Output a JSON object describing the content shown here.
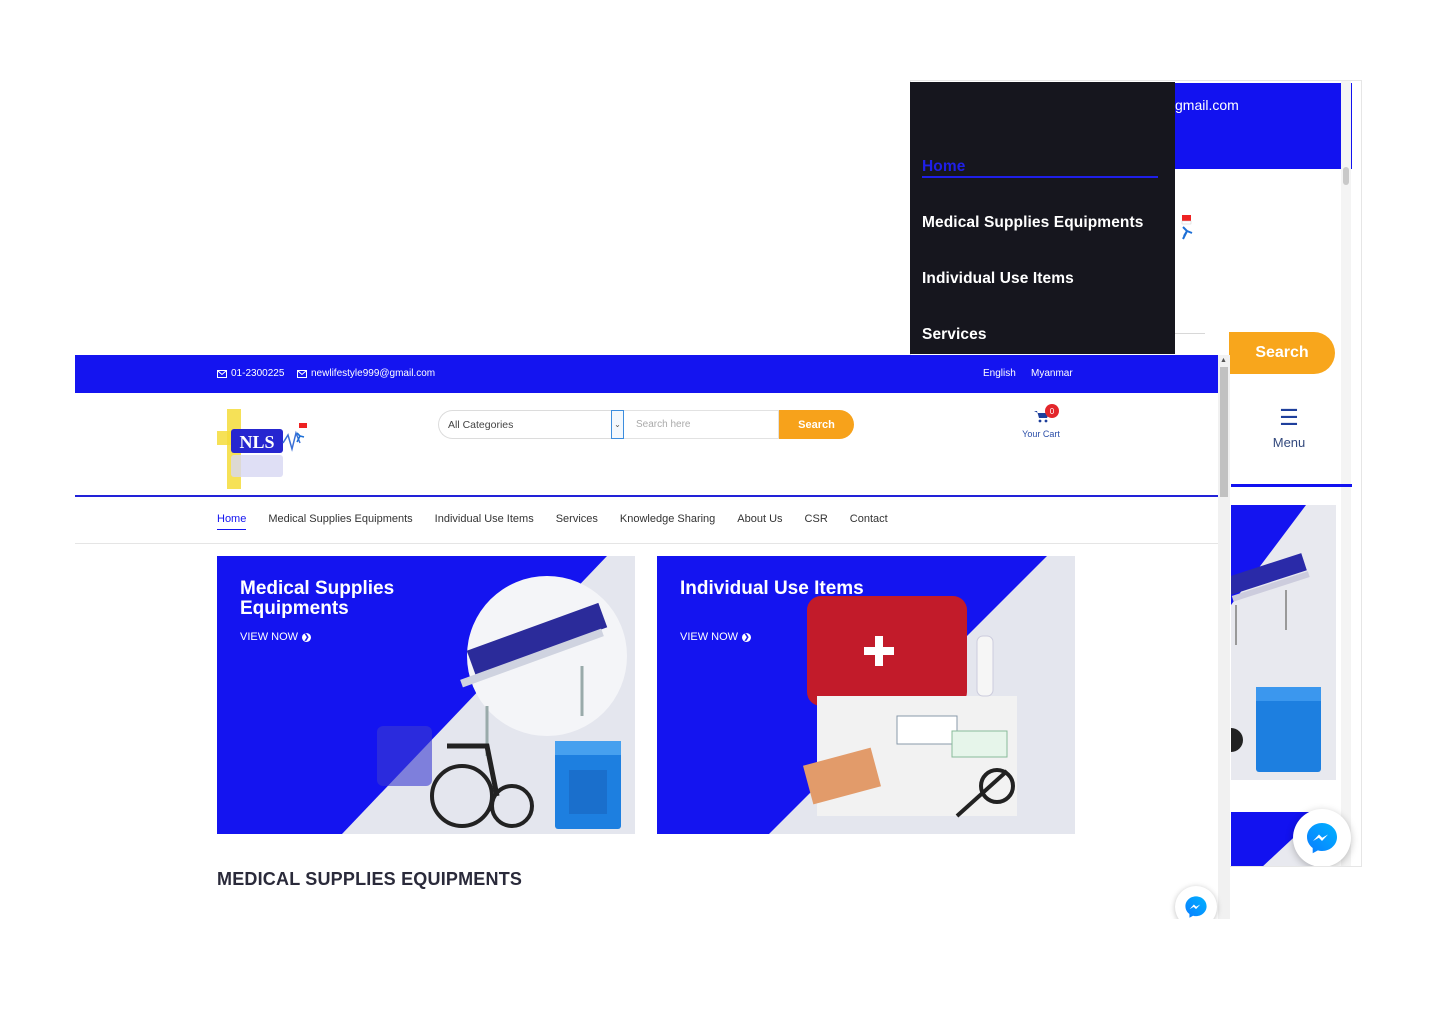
{
  "mobile": {
    "email_fragment": "gmail.com",
    "search_label": "Search",
    "menu_label": "Menu",
    "drawer": {
      "items": [
        {
          "label": "Home",
          "active": true
        },
        {
          "label": "Medical Supplies Equipments",
          "active": false
        },
        {
          "label": "Individual Use Items",
          "active": false
        },
        {
          "label": "Services",
          "active": false
        }
      ]
    }
  },
  "desktop": {
    "topbar": {
      "phone": "01-2300225",
      "email": "newlifestyle999@gmail.com",
      "languages": [
        "English",
        "Myanmar"
      ]
    },
    "logo_text": "NLS",
    "search": {
      "category": "All Categories",
      "placeholder": "Search here",
      "button": "Search"
    },
    "cart": {
      "count": "0",
      "label": "Your Cart"
    },
    "nav": [
      "Home",
      "Medical Supplies Equipments",
      "Individual Use Items",
      "Services",
      "Knowledge Sharing",
      "About Us",
      "CSR",
      "Contact"
    ],
    "banners": [
      {
        "title": "Medical Supplies Equipments",
        "cta": "VIEW NOW"
      },
      {
        "title": "Individual Use Items",
        "cta": "VIEW NOW"
      }
    ],
    "section_title": "MEDICAL SUPPLIES EQUIPMENTS"
  },
  "colors": {
    "brand_blue": "#1414f0",
    "accent_orange": "#f7a21b",
    "drawer_bg": "#16161e",
    "badge_red": "#e3262b"
  },
  "icons": [
    "envelope-icon",
    "chevron-down-icon",
    "cart-icon",
    "hamburger-icon",
    "arrow-circle-right-icon",
    "messenger-icon"
  ]
}
